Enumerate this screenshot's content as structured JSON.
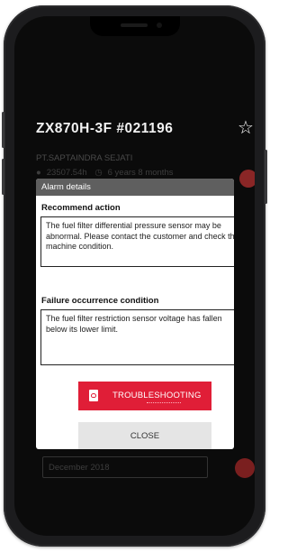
{
  "app": {
    "title": "ZX870H-3F #021196",
    "company": "PT.SAPTAINDRA SEJATI",
    "hours": "23507.54h",
    "age": "6 years 8 months",
    "date_value": "December 2018"
  },
  "dialog": {
    "header": "Alarm details",
    "recommend_label": "Recommend action",
    "recommend_text": "The fuel filter differential pressure sensor may be abnormal. Please contact the customer and check the machine condition.",
    "failure_label": "Failure occurrence condition",
    "failure_text": "The fuel filter restriction sensor voltage has fallen below its lower limit.",
    "troubleshooting_label": "TROUBLESHOOTING",
    "close_label": "CLOSE"
  },
  "colors": {
    "accent_red": "#e01e37",
    "header_gray": "#5f5f5f",
    "screen_bg": "#0b0b0b"
  },
  "icons": [
    "star-icon",
    "location-pin-icon",
    "clock-icon",
    "pdf-icon"
  ]
}
